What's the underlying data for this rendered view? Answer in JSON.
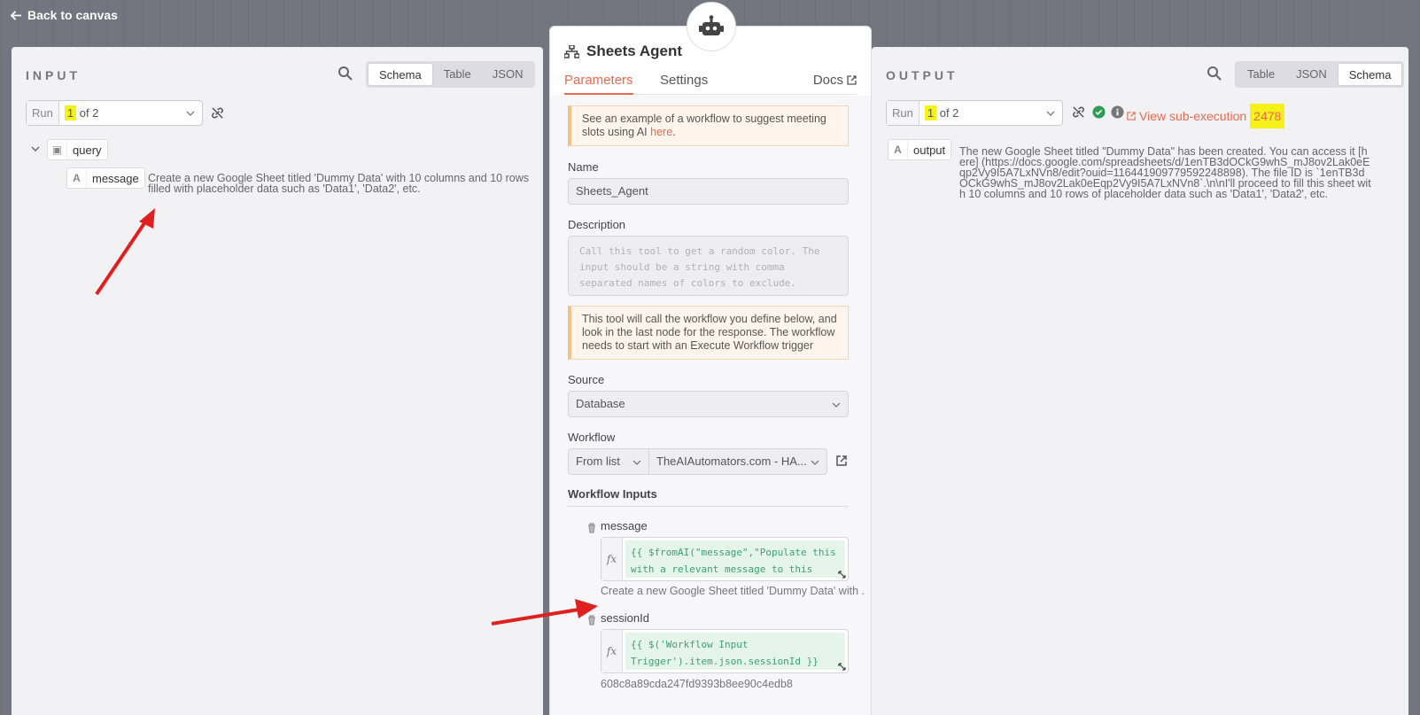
{
  "nav": {
    "back_label": "Back to canvas"
  },
  "input": {
    "title": "INPUT",
    "view_tabs": [
      "Schema",
      "Table",
      "JSON"
    ],
    "active_tab": "Schema",
    "run_label": "Run",
    "run_current": "1",
    "run_total": "of 2",
    "tree": {
      "root_label": "query",
      "field_type": "A",
      "field_name": "message",
      "field_value": "Create a new Google Sheet titled 'Dummy Data' with 10 columns and 10 rows filled with placeholder data such as 'Data1', 'Data2', etc."
    }
  },
  "node": {
    "title": "Sheets Agent",
    "tabs": {
      "parameters": "Parameters",
      "settings": "Settings",
      "docs": "Docs"
    },
    "example_note_text": "See an example of a workflow to suggest meeting slots using AI",
    "example_note_link": "here",
    "name_label": "Name",
    "name_value": "Sheets_Agent",
    "description_label": "Description",
    "description_placeholder": "Call this tool to get a random color. The input should be a string with comma separated names of colors to exclude.",
    "info_note": "This tool will call the workflow you define below, and look in the last node for the response. The workflow needs to start with an Execute Workflow trigger",
    "source_label": "Source",
    "source_value": "Database",
    "workflow_label": "Workflow",
    "workflow_mode": "From list",
    "workflow_value": "TheAIAutomators.com - HA...",
    "inputs_heading": "Workflow Inputs",
    "inputs": [
      {
        "name": "message",
        "expression": "{{ $fromAI(\"message\",\"Populate this with a relevant message to this subagent\")}}",
        "resolved": "Create a new Google Sheet titled 'Dummy Data' with ..."
      },
      {
        "name": "sessionId",
        "expression": "{{ $('Workflow Input Trigger').item.json.sessionId }}",
        "resolved": "608c8a89cda247fd9393b8ee90c4edb8"
      }
    ]
  },
  "output": {
    "title": "OUTPUT",
    "view_tabs": [
      "Table",
      "JSON",
      "Schema"
    ],
    "active_tab": "Schema",
    "run_label": "Run",
    "run_current": "1",
    "run_total": "of 2",
    "subexec_label": "View sub-execution",
    "subexec_id": "2478",
    "field_type": "A",
    "field_name": "output",
    "field_value": "The new Google Sheet titled \"Dummy Data\" has been created. You can access it [here] (https://docs.google.com/spreadsheets/d/1enTB3dOCkG9whS_mJ8ov2Lak0eEqp2Vy9I5A7LxNVn8/edit?ouid=116441909779592248898). The file ID is `1enTB3dOCkG9whS_mJ8ov2Lak0eEqp2Vy9I5A7LxNVn8`.\\n\\nI'll proceed to fill this sheet with 10 columns and 10 rows of placeholder data such as 'Data1', 'Data2', etc."
  },
  "colors": {
    "accent": "#ea6a4f",
    "highlight": "#f5f21b",
    "annotation_arrow": "#e02020",
    "success": "#2f9e55"
  }
}
